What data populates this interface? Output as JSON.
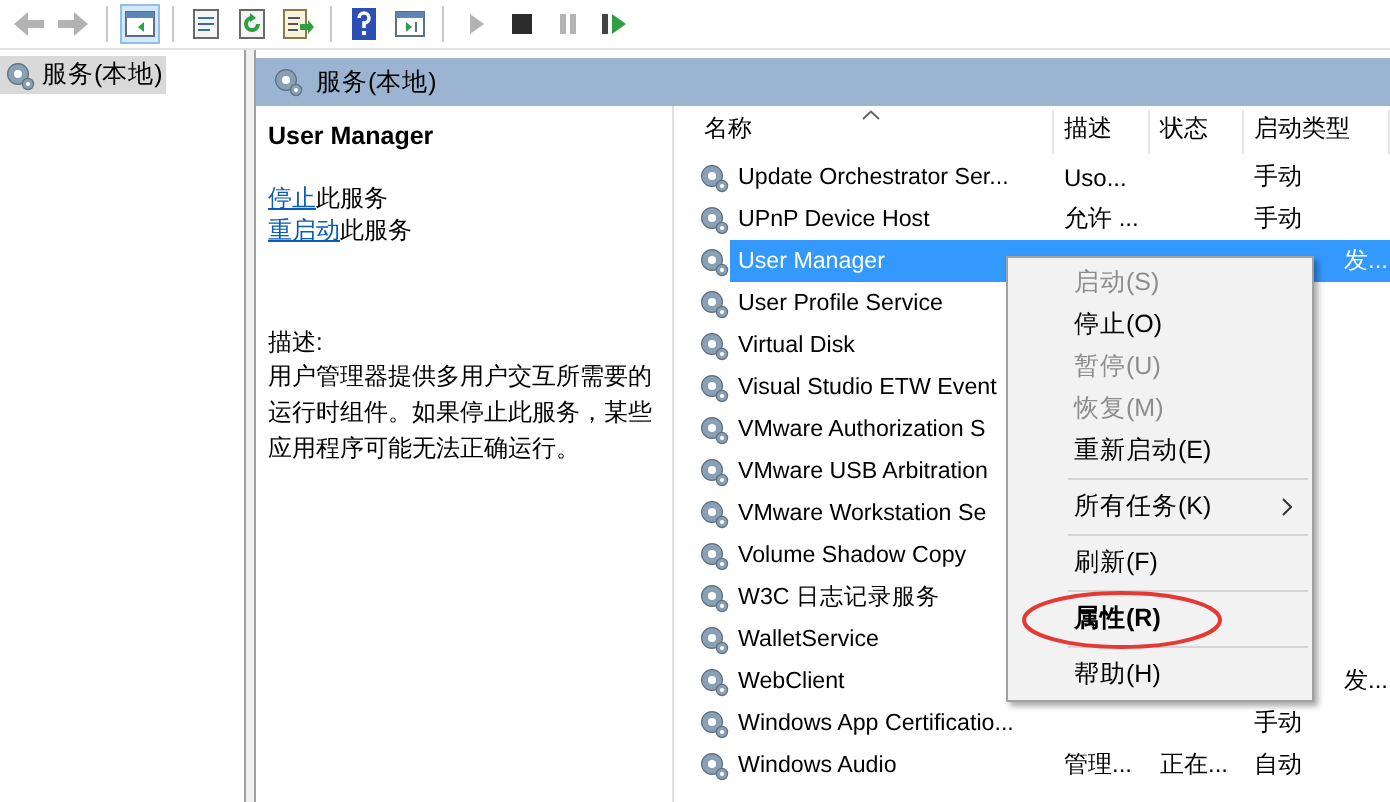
{
  "toolbar": {
    "buttons": [
      {
        "kind": "back",
        "disabled": true
      },
      {
        "kind": "forward",
        "disabled": true
      },
      {
        "kind": "sep"
      },
      {
        "kind": "tree",
        "selected": true
      },
      {
        "kind": "sep"
      },
      {
        "kind": "properties"
      },
      {
        "kind": "refresh"
      },
      {
        "kind": "export"
      },
      {
        "kind": "sep"
      },
      {
        "kind": "help"
      },
      {
        "kind": "view"
      },
      {
        "kind": "sep"
      },
      {
        "kind": "start",
        "disabled": true
      },
      {
        "kind": "stop",
        "disabled": false
      },
      {
        "kind": "pause",
        "disabled": true
      },
      {
        "kind": "resume",
        "disabled": false
      }
    ]
  },
  "tree": {
    "items": [
      {
        "label": "服务(本地)",
        "selected": true
      }
    ]
  },
  "pane": {
    "title": "服务(本地)",
    "detail": {
      "service": "User Manager",
      "actions": [
        {
          "link": "停止",
          "rest": "此服务"
        },
        {
          "link": "重启动",
          "rest": "此服务"
        }
      ],
      "description_label": "描述:",
      "description": "用户管理器提供多用户交互所需要的运行时组件。如果停止此服务，某些应用程序可能无法正确运行。"
    },
    "table": {
      "columns": [
        {
          "label": "名称",
          "sorted": true
        },
        {
          "label": "描述"
        },
        {
          "label": "状态"
        },
        {
          "label": "启动类型"
        }
      ],
      "rows": [
        {
          "name": "Update Orchestrator Ser...",
          "description": "Uso...",
          "status": "",
          "startup": "手动",
          "selected": false
        },
        {
          "name": "UPnP Device Host",
          "description": "允许 ...",
          "status": "",
          "startup": "手动",
          "selected": false
        },
        {
          "name": "User Manager",
          "description": "",
          "status": "",
          "startup_tail": "发...",
          "selected": true
        },
        {
          "name": "User Profile Service",
          "description": "",
          "status": "",
          "startup": "",
          "selected": false
        },
        {
          "name": "Virtual Disk",
          "description": "",
          "status": "",
          "startup": "",
          "selected": false
        },
        {
          "name": "Visual Studio ETW Event",
          "description": "",
          "status": "",
          "startup": "",
          "selected": false
        },
        {
          "name": "VMware Authorization S",
          "description": "",
          "status": "",
          "startup": "",
          "selected": false
        },
        {
          "name": "VMware USB Arbitration",
          "description": "",
          "status": "",
          "startup": "",
          "selected": false
        },
        {
          "name": "VMware Workstation Se",
          "description": "",
          "status": "",
          "startup": "",
          "selected": false
        },
        {
          "name": "Volume Shadow Copy",
          "description": "",
          "status": "",
          "startup": "",
          "selected": false
        },
        {
          "name": "W3C 日志记录服务",
          "description": "",
          "status": "",
          "startup": "",
          "selected": false
        },
        {
          "name": "WalletService",
          "description": "",
          "status": "",
          "startup": "",
          "selected": false
        },
        {
          "name": "WebClient",
          "description": "",
          "status": "",
          "startup_tail": "发...",
          "selected": false
        },
        {
          "name": "Windows App Certificatio...",
          "description": "",
          "status": "",
          "startup": "手动",
          "selected": false
        },
        {
          "name": "Windows Audio",
          "description": "管理...",
          "status": "正在...",
          "startup": "自动",
          "selected": false
        }
      ]
    }
  },
  "context_menu": {
    "items": [
      {
        "kind": "item",
        "label": "启动(S)",
        "disabled": true
      },
      {
        "kind": "item",
        "label": "停止(O)",
        "disabled": false
      },
      {
        "kind": "item",
        "label": "暂停(U)",
        "disabled": true
      },
      {
        "kind": "item",
        "label": "恢复(M)",
        "disabled": true
      },
      {
        "kind": "item",
        "label": "重新启动(E)",
        "disabled": false
      },
      {
        "kind": "separator"
      },
      {
        "kind": "submenu",
        "label": "所有任务(K)",
        "disabled": false
      },
      {
        "kind": "separator"
      },
      {
        "kind": "item",
        "label": "刷新(F)",
        "disabled": false
      },
      {
        "kind": "separator"
      },
      {
        "kind": "item",
        "label": "属性(R)",
        "disabled": false,
        "default": true,
        "circled": true
      },
      {
        "kind": "separator"
      },
      {
        "kind": "item",
        "label": "帮助(H)",
        "disabled": false
      }
    ]
  }
}
